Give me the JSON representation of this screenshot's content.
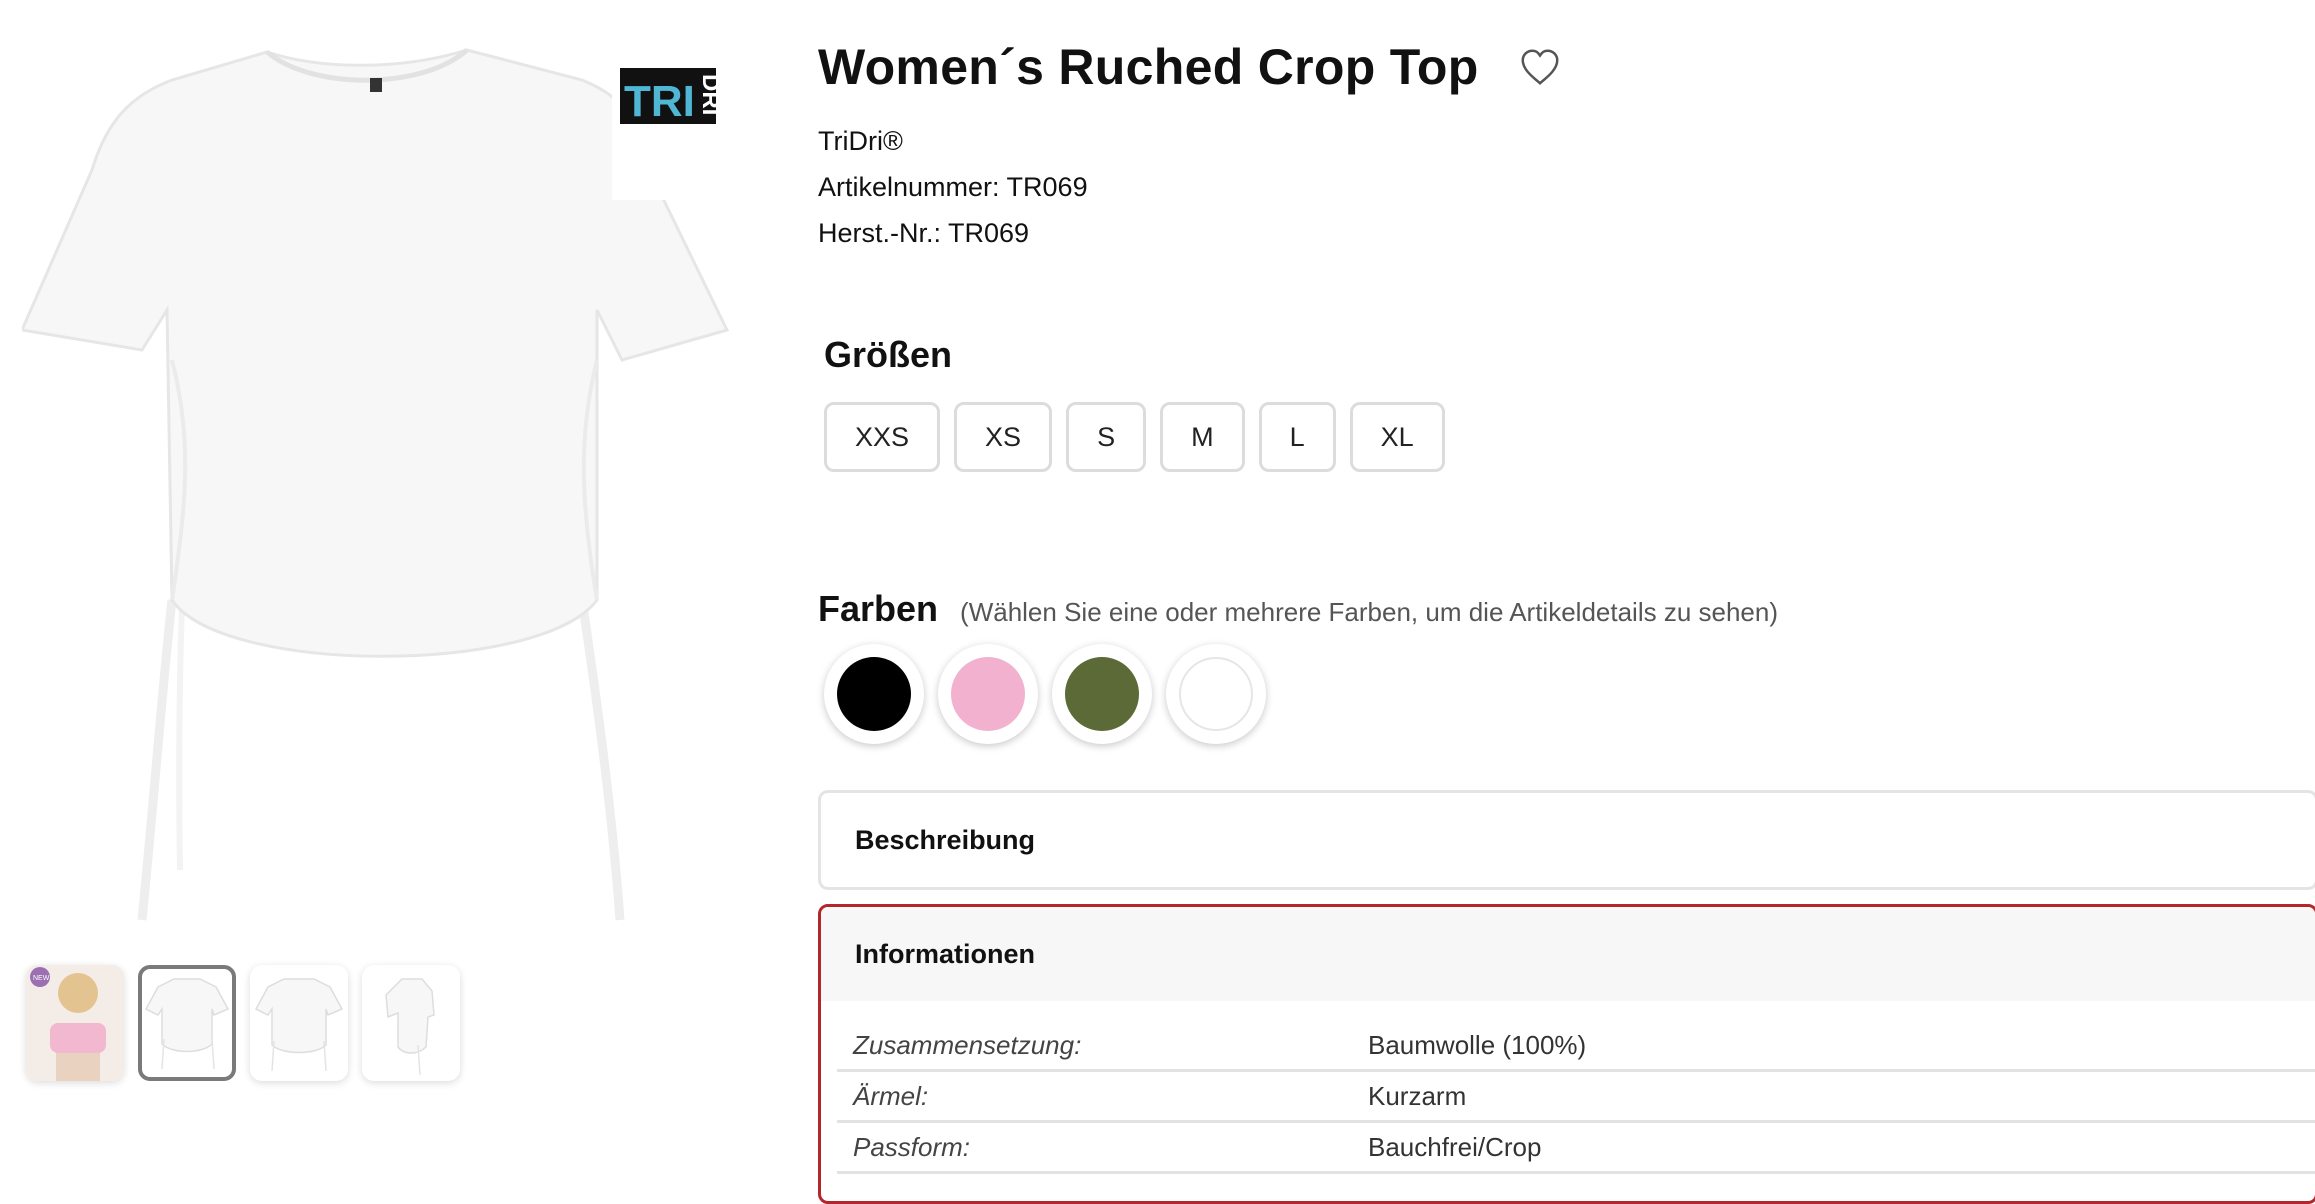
{
  "product": {
    "title": "Women´s Ruched Crop Top",
    "brand": "TriDri®",
    "article_number": "Artikelnummer: TR069",
    "manufacturer_number": "Herst.-Nr.: TR069",
    "logo_text_top": "TRI",
    "logo_text_side": "DRI"
  },
  "wishlist": {
    "icon": "heart-icon"
  },
  "gallery": {
    "selected_index": 1,
    "thumbnails": [
      {
        "name": "model-pink",
        "badge": "NEW"
      },
      {
        "name": "front-white"
      },
      {
        "name": "back-white"
      },
      {
        "name": "side-white"
      }
    ]
  },
  "sizes": {
    "title": "Größen",
    "options": [
      "XXS",
      "XS",
      "S",
      "M",
      "L",
      "XL"
    ]
  },
  "colors": {
    "title": "Farben",
    "hint": "(Wählen Sie eine oder mehrere Farben, um die Artikeldetails zu sehen)",
    "swatches": [
      "#000000",
      "#f2b2cf",
      "#5b6a36",
      "#ffffff"
    ]
  },
  "accordions": {
    "description_label": "Beschreibung",
    "info_label": "Informationen",
    "info_rows": [
      {
        "key": "Zusammensetzung:",
        "value": "Baumwolle (100%)"
      },
      {
        "key": "Ärmel:",
        "value": "Kurzarm"
      },
      {
        "key": "Passform:",
        "value": "Bauchfrei/Crop"
      }
    ]
  },
  "colors_theme": {
    "active_border": "#b3262b",
    "logo_blue": "#4fb6d3"
  }
}
